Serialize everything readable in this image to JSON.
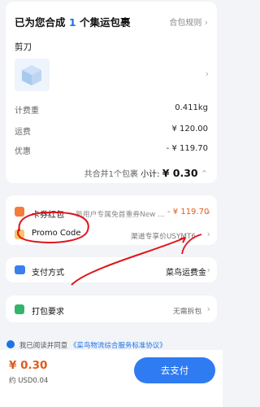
{
  "package": {
    "title_prefix": "已为您合成",
    "title_count": "1",
    "title_suffix": "个集运包裹",
    "rule_link": "合包规则",
    "item_name": "剪刀",
    "rows": [
      {
        "label": "计费重",
        "value": "0.411kg"
      },
      {
        "label": "运费",
        "value": "¥ 120.00"
      },
      {
        "label": "优惠",
        "value": "- ¥ 119.70"
      }
    ],
    "package_count": "共合并1个包裹",
    "subtotal_label": "小计:",
    "subtotal_amount": "¥ 0.30"
  },
  "coupon": {
    "label": "卡券红包",
    "desc": "新用户专属免首重券New ...",
    "amount": "- ¥ 119.70"
  },
  "promo": {
    "label": "Promo Code",
    "value": "渠道专享价USYMT6"
  },
  "payment": {
    "label": "支付方式",
    "value": "菜鸟运费金"
  },
  "packing": {
    "label": "打包要求",
    "value": "无需拆包"
  },
  "agreement": {
    "prefix": "我已阅读并同意",
    "link": "《菜鸟物流综合服务标准协议》"
  },
  "footer": {
    "total": "¥ 0.30",
    "total_usd": "约 USD0.04",
    "pay_button": "去支付"
  },
  "colors": {
    "accent_blue": "#2f7bf1",
    "price_orange": "#e25a18",
    "annotation_red": "#e0141b"
  }
}
